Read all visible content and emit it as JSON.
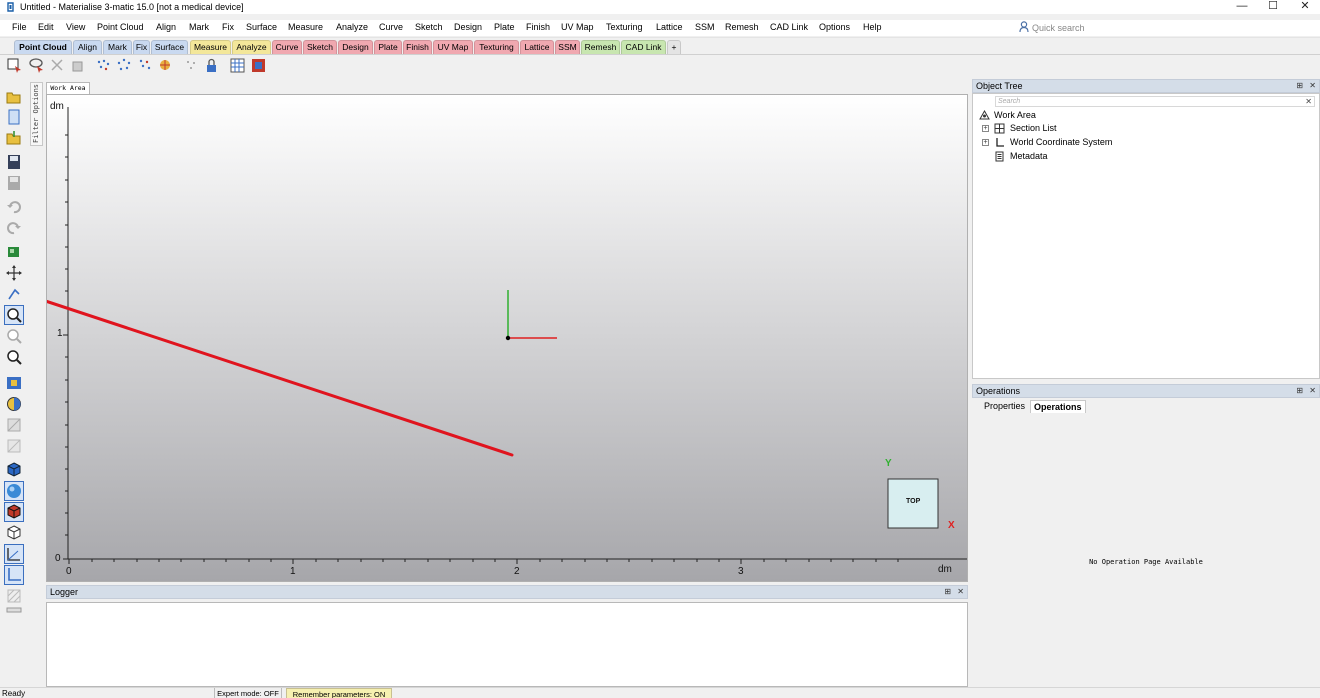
{
  "window": {
    "title": "Untitled - Materialise 3-matic 15.0 [not a medical device]",
    "controls": [
      "—",
      "☐",
      "✕"
    ]
  },
  "menubar": {
    "items": [
      "File",
      "Edit",
      "View",
      "Point Cloud",
      "Align",
      "Mark",
      "Fix",
      "Surface",
      "Measure",
      "Analyze",
      "Curve",
      "Sketch",
      "Design",
      "Plate",
      "Finish",
      "UV Map",
      "Texturing",
      "Lattice",
      "SSM",
      "Remesh",
      "CAD Link",
      "Options",
      "Help"
    ],
    "quick_search_placeholder": "Quick search"
  },
  "tabs": [
    {
      "label": "Point Cloud",
      "color": "#c9d9f0",
      "active": true
    },
    {
      "label": "Align",
      "color": "#c9d9f0"
    },
    {
      "label": "Mark",
      "color": "#c9d9f0"
    },
    {
      "label": "Fix",
      "color": "#c9d9f0"
    },
    {
      "label": "Surface",
      "color": "#c9d9f0"
    },
    {
      "label": "Measure",
      "color": "#f3e79a"
    },
    {
      "label": "Analyze",
      "color": "#f3e79a"
    },
    {
      "label": "Curve",
      "color": "#f0a8b0"
    },
    {
      "label": "Sketch",
      "color": "#f0a8b0"
    },
    {
      "label": "Design",
      "color": "#f0a8b0"
    },
    {
      "label": "Plate",
      "color": "#f0a8b0"
    },
    {
      "label": "Finish",
      "color": "#f0a8b0"
    },
    {
      "label": "UV Map",
      "color": "#f0a8b0"
    },
    {
      "label": "Texturing",
      "color": "#f0a8b0"
    },
    {
      "label": "Lattice",
      "color": "#f0a8b0"
    },
    {
      "label": "SSM",
      "color": "#f0a8b0"
    },
    {
      "label": "Remesh",
      "color": "#c8e6b0"
    },
    {
      "label": "CAD Link",
      "color": "#c8e6b0"
    },
    {
      "label": "+",
      "color": "#e4e4e4"
    }
  ],
  "toolbar_icons": [
    "select-icon",
    "lasso-select-icon",
    "deselect-icon",
    "invert-select-icon",
    "point-select-icon",
    "points-select-icon",
    "point-cloud-select-icon",
    "render-icon",
    "scatter-icon",
    "lock-icon",
    "grid-icon",
    "screenshot-icon"
  ],
  "left_toolbar_icons": [
    "open-folder-icon",
    "new-document-icon",
    "import-icon",
    "save-icon",
    "save-disabled-icon",
    "undo-icon",
    "redo-icon",
    "model-icon",
    "pan-icon",
    "rotate-icon",
    "zoom-fit-icon",
    "zoom-disabled-icon",
    "zoom-icon",
    "view-image-icon",
    "palette-icon",
    "transparency-icon",
    "section-icon",
    "cube-view-icon",
    "sphere-view-icon",
    "cube-shaded-icon",
    "wireframe-cube-icon",
    "measure-axes-icon",
    "coordinate-icon",
    "hatch-icon"
  ],
  "filter_options_label": "Filter Options",
  "work_area": {
    "tab_label": "Work Area",
    "unit_y": "dm",
    "unit_x": "dm",
    "y_ticks": [
      "1",
      "0"
    ],
    "x_ticks": [
      "0",
      "1",
      "2",
      "3"
    ],
    "axis_colors": {
      "x": "#e02020",
      "y": "#30b030",
      "origin": "#000000"
    },
    "view_cube": {
      "label": "TOP",
      "x_label": "X",
      "y_label": "Y"
    }
  },
  "logger": {
    "title": "Logger",
    "controls": [
      "⊞",
      "✕"
    ]
  },
  "object_tree": {
    "title": "Object Tree",
    "controls": [
      "⊞",
      "✕"
    ],
    "search_placeholder": "Search",
    "search_clear": "✕",
    "nodes": [
      "Work Area",
      "Section List",
      "World Coordinate System",
      "Metadata"
    ]
  },
  "operations": {
    "title": "Operations",
    "controls": [
      "⊞",
      "✕"
    ],
    "tabs": [
      "Properties",
      "Operations"
    ],
    "empty_message": "No Operation Page Available"
  },
  "statusbar": {
    "ready": "Ready",
    "expert_mode": "Expert mode: OFF",
    "remember_params": "Remember parameters: ON"
  }
}
